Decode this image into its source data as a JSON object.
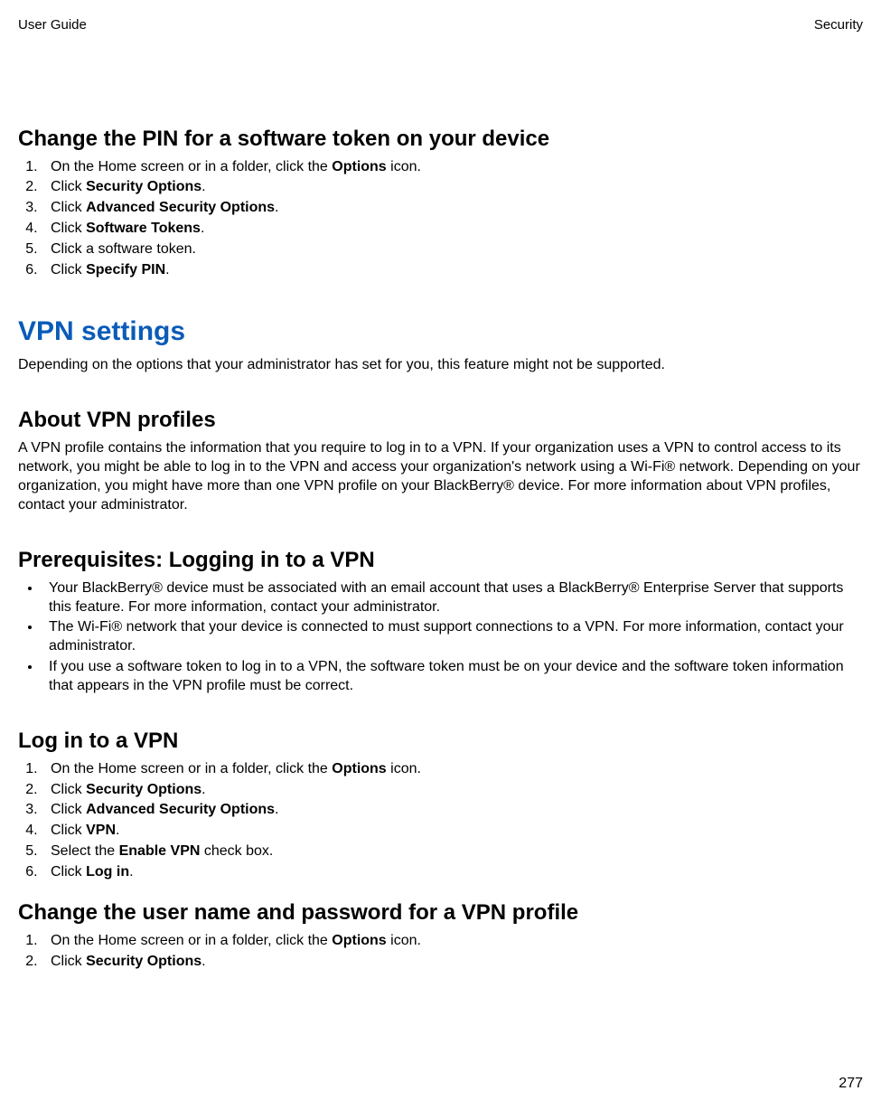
{
  "header": {
    "left": "User Guide",
    "right": "Security"
  },
  "sections": {
    "change_pin": {
      "title": "Change the PIN for a software token on your device",
      "steps": [
        {
          "pre": "On the Home screen or in a folder, click the ",
          "bold": "Options",
          "post": " icon."
        },
        {
          "pre": "Click ",
          "bold": "Security Options",
          "post": "."
        },
        {
          "pre": "Click ",
          "bold": "Advanced Security Options",
          "post": "."
        },
        {
          "pre": "Click ",
          "bold": "Software Tokens",
          "post": "."
        },
        {
          "pre": "Click a software token.",
          "bold": "",
          "post": ""
        },
        {
          "pre": "Click ",
          "bold": "Specify PIN",
          "post": "."
        }
      ]
    },
    "vpn_settings": {
      "title": "VPN settings",
      "intro": "Depending on the options that your administrator has set for you, this feature might not be supported."
    },
    "about_vpn": {
      "title": "About VPN profiles",
      "body": "A VPN profile contains the information that you require to log in to a VPN. If your organization uses a VPN to control access to its network, you might be able to log in to the VPN and access your organization's network using a Wi-Fi® network. Depending on your organization, you might have more than one VPN profile on your BlackBerry® device. For more information about VPN profiles, contact your administrator."
    },
    "prereq": {
      "title": "Prerequisites: Logging in to a VPN",
      "items": [
        "Your BlackBerry® device must be associated with an email account that uses a BlackBerry® Enterprise Server that supports this feature. For more information, contact your administrator.",
        "The Wi-Fi® network that your device is connected to must support connections to a VPN. For more information, contact your administrator.",
        "If you use a software token to log in to a VPN, the software token must be on your device and the software token information that appears in the VPN profile must be correct."
      ]
    },
    "login_vpn": {
      "title": "Log in to a VPN",
      "steps": [
        {
          "pre": "On the Home screen or in a folder, click the ",
          "bold": "Options",
          "post": " icon."
        },
        {
          "pre": "Click ",
          "bold": "Security Options",
          "post": "."
        },
        {
          "pre": "Click ",
          "bold": "Advanced Security Options",
          "post": "."
        },
        {
          "pre": "Click ",
          "bold": "VPN",
          "post": "."
        },
        {
          "pre": "Select the ",
          "bold": "Enable VPN",
          "post": " check box."
        },
        {
          "pre": "Click ",
          "bold": "Log in",
          "post": "."
        }
      ]
    },
    "change_user": {
      "title": "Change the user name and password for a VPN profile",
      "steps": [
        {
          "pre": "On the Home screen or in a folder, click the ",
          "bold": "Options",
          "post": " icon."
        },
        {
          "pre": "Click ",
          "bold": "Security Options",
          "post": "."
        }
      ]
    }
  },
  "page_number": "277"
}
